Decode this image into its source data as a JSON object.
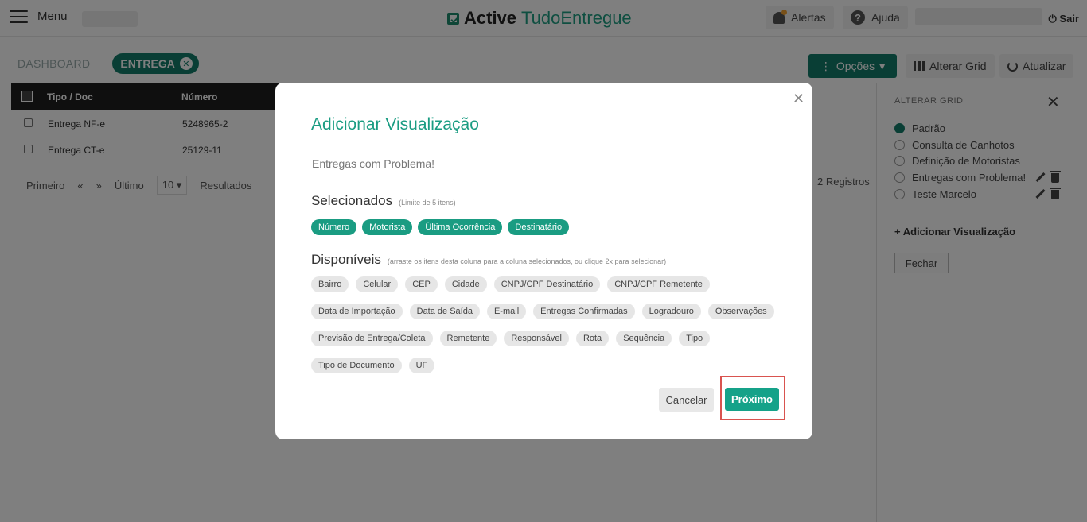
{
  "topbar": {
    "menu_label": "Menu",
    "logo_active": "Active",
    "logo_tudo": "TudoEntregue",
    "alerts_label": "Alertas",
    "help_label": "Ajuda",
    "logout_label": "⏻ Sair"
  },
  "tabs": {
    "dashboard": "DASHBOARD",
    "entrega": "ENTREGA"
  },
  "toolbar": {
    "options_label": "Opções",
    "alter_grid_label": "Alterar Grid",
    "refresh_label": "Atualizar"
  },
  "table": {
    "headers": [
      "Tipo / Doc",
      "Número"
    ],
    "rows": [
      {
        "tipo": "Entrega NF-e",
        "numero": "5248965-2"
      },
      {
        "tipo": "Entrega CT-e",
        "numero": "25129-11"
      }
    ]
  },
  "pager": {
    "first": "Primeiro",
    "prev": "«",
    "next": "»",
    "last": "Último",
    "page_size": "10",
    "results_label": "Resultados",
    "total": "2 Registros"
  },
  "side_panel": {
    "title": "ALTERAR GRID",
    "options": [
      "Padrão",
      "Consulta de Canhotos",
      "Definição de Motoristas",
      "Entregas com Problema!",
      "Teste Marcelo"
    ],
    "selected_option": "Padrão",
    "add_label": "+ Adicionar Visualização",
    "close_label": "Fechar"
  },
  "modal": {
    "title": "Adicionar Visualização",
    "name_placeholder": "Entregas com Problema!",
    "selected_title": "Selecionados",
    "selected_hint": "(Limite de 5 itens)",
    "selected_items": [
      "Número",
      "Motorista",
      "Última Ocorrência",
      "Destinatário"
    ],
    "available_title": "Disponíveis",
    "available_hint": "(arraste os itens desta coluna para a coluna selecionados, ou clique 2x para selecionar)",
    "available_items": [
      "Bairro",
      "Celular",
      "CEP",
      "Cidade",
      "CNPJ/CPF Destinatário",
      "CNPJ/CPF Remetente",
      "Data de Importação",
      "Data de Saída",
      "E-mail",
      "Entregas Confirmadas",
      "Logradouro",
      "Observações",
      "Previsão de Entrega/Coleta",
      "Remetente",
      "Responsável",
      "Rota",
      "Sequência",
      "Tipo",
      "Tipo de Documento",
      "UF"
    ],
    "cancel_label": "Cancelar",
    "next_label": "Próximo"
  },
  "colors": {
    "accent": "#1a9c82",
    "brand_dark": "#137d6a",
    "highlight": "#d9534f"
  }
}
